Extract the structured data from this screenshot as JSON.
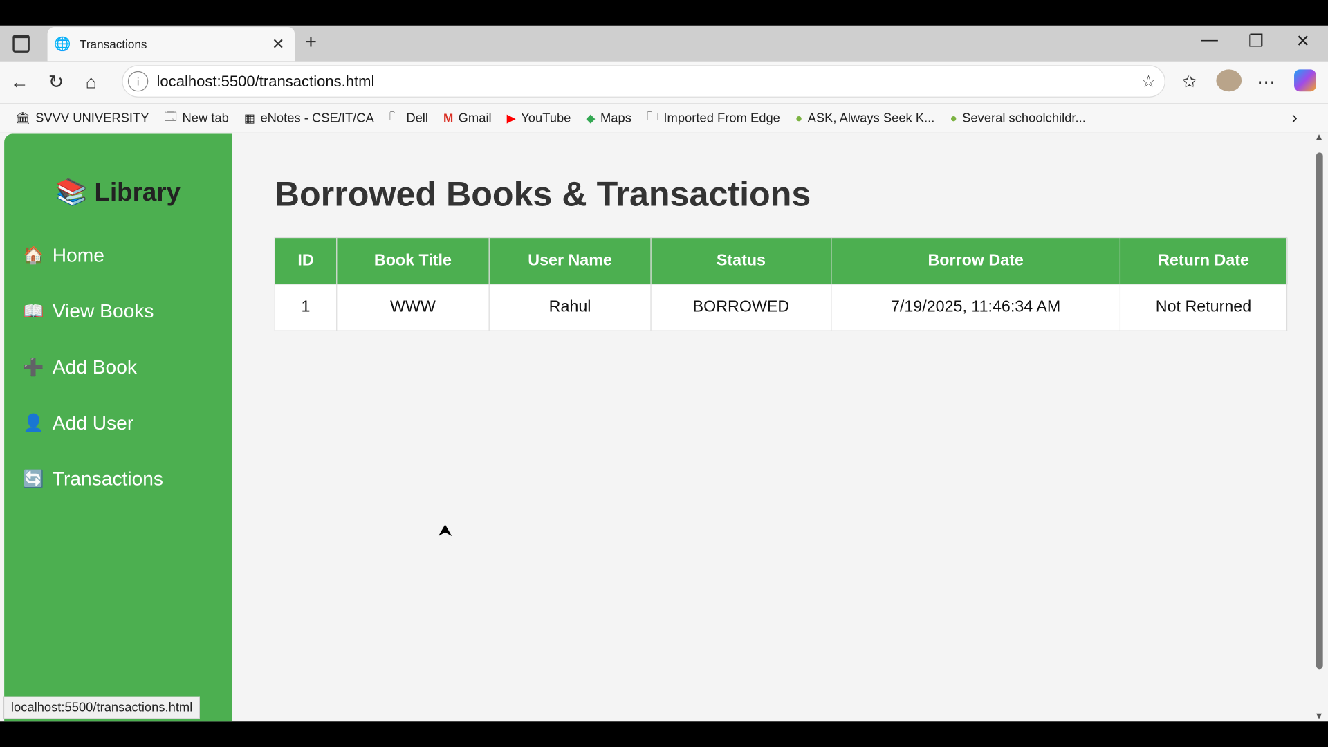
{
  "browser": {
    "tab_title": "Transactions",
    "url": "localhost:5500/transactions.html",
    "status_url": "localhost:5500/transactions.html",
    "bookmarks": [
      {
        "label": "SVVV UNIVERSITY",
        "icon": "university-logo-icon"
      },
      {
        "label": "New tab",
        "icon": "new-tab-icon"
      },
      {
        "label": "eNotes - CSE/IT/CA",
        "icon": "enotes-icon"
      },
      {
        "label": "Dell",
        "icon": "folder-icon"
      },
      {
        "label": "Gmail",
        "icon": "gmail-icon"
      },
      {
        "label": "YouTube",
        "icon": "youtube-icon"
      },
      {
        "label": "Maps",
        "icon": "maps-icon"
      },
      {
        "label": "Imported From Edge",
        "icon": "folder-icon"
      },
      {
        "label": "ASK, Always Seek K...",
        "icon": "leaf-icon"
      },
      {
        "label": "Several schoolchildr...",
        "icon": "leaf-icon"
      }
    ]
  },
  "sidebar": {
    "title": "Library",
    "items": [
      {
        "label": "Home",
        "icon": "house-icon"
      },
      {
        "label": "View Books",
        "icon": "open-book-icon"
      },
      {
        "label": "Add Book",
        "icon": "plus-icon"
      },
      {
        "label": "Add User",
        "icon": "user-icon"
      },
      {
        "label": "Transactions",
        "icon": "refresh-icon"
      }
    ]
  },
  "main": {
    "title": "Borrowed Books & Transactions",
    "columns": [
      "ID",
      "Book Title",
      "User Name",
      "Status",
      "Borrow Date",
      "Return Date"
    ],
    "rows": [
      [
        "1",
        "WWW",
        "Rahul",
        "BORROWED",
        "7/19/2025, 11:46:34 AM",
        "Not Returned"
      ]
    ]
  },
  "colors": {
    "accent": "#4caf50"
  }
}
